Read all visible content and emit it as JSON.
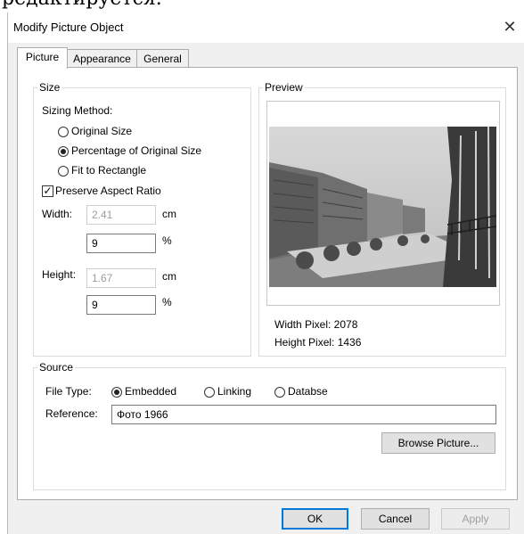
{
  "background_text": "редактируется.",
  "dialog": {
    "title": "Modify Picture Object",
    "close_glyph": "✕"
  },
  "tabs": [
    {
      "label": "Picture",
      "active": true
    },
    {
      "label": "Appearance",
      "active": false
    },
    {
      "label": "General",
      "active": false
    }
  ],
  "size": {
    "group_label": "Size",
    "sizing_method_label": "Sizing Method:",
    "options": [
      {
        "label": "Original Size",
        "selected": false
      },
      {
        "label": "Percentage of Original Size",
        "selected": true
      },
      {
        "label": "Fit to Rectangle",
        "selected": false
      }
    ],
    "preserve_aspect_label": "Preserve Aspect Ratio",
    "preserve_aspect_checked": true,
    "check_glyph": "✓",
    "width_label": "Width:",
    "width_value": "2.41",
    "width_unit": "cm",
    "width_percent": "9",
    "percent_unit": "%",
    "height_label": "Height:",
    "height_value": "1.67",
    "height_unit": "cm",
    "height_percent": "9"
  },
  "preview": {
    "group_label": "Preview",
    "width_pixel": "Width Pixel: 2078",
    "height_pixel": "Height Pixel: 1436"
  },
  "source": {
    "group_label": "Source",
    "file_type_label": "File Type:",
    "options": [
      {
        "label": "Embedded",
        "selected": true
      },
      {
        "label": "Linking",
        "selected": false
      },
      {
        "label": "Databse",
        "selected": false
      }
    ],
    "reference_label": "Reference:",
    "reference_value": "Фото 1966",
    "browse_label": "Browse Picture..."
  },
  "buttons": {
    "ok": "OK",
    "cancel": "Cancel",
    "apply": "Apply"
  }
}
